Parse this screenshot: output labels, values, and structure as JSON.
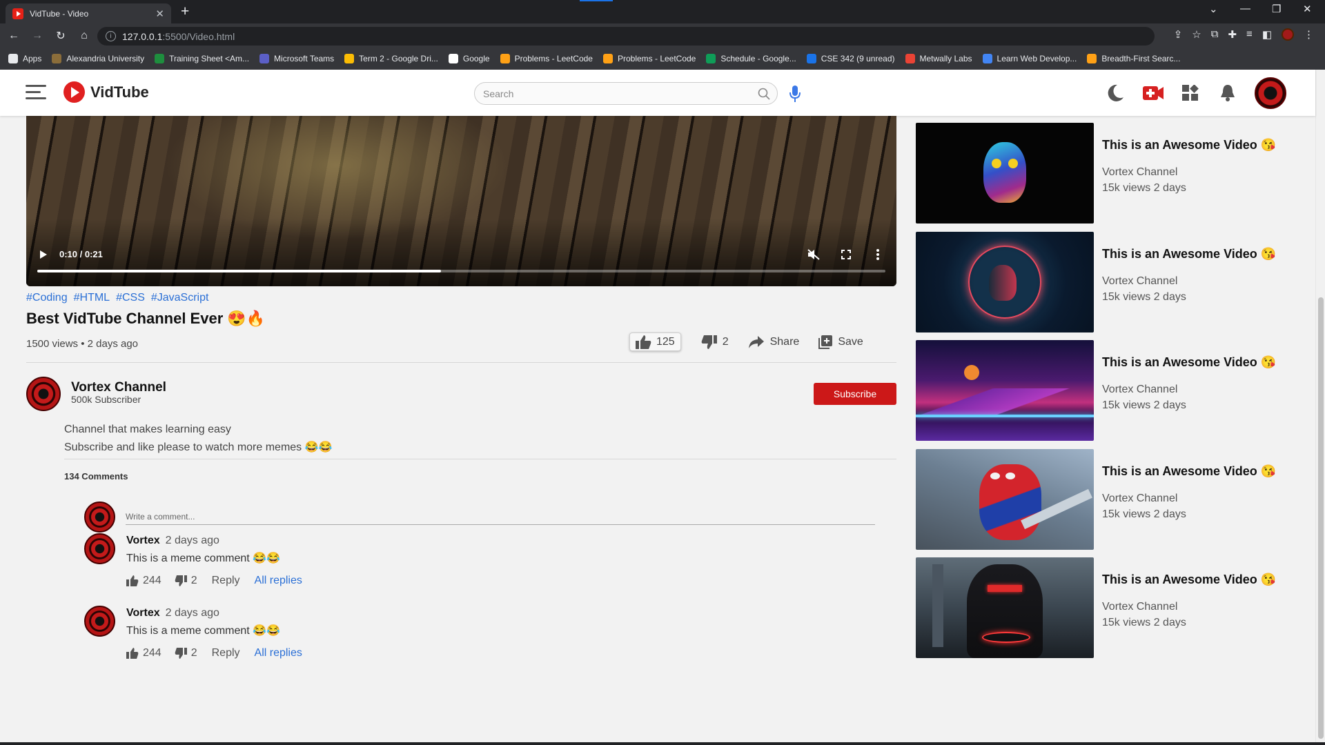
{
  "browser": {
    "tab_title": "VidTube - Video",
    "url_host": "127.0.0.1",
    "url_path": ":5500/Video.html",
    "bookmarks": [
      {
        "label": "Apps",
        "color": "#e8eaed"
      },
      {
        "label": "Alexandria University",
        "color": "#8b6d3a"
      },
      {
        "label": "Training Sheet <Am...",
        "color": "#1e8e3e"
      },
      {
        "label": "Microsoft Teams",
        "color": "#5b5fc7"
      },
      {
        "label": "Term 2 - Google Dri...",
        "color": "#fbbc04"
      },
      {
        "label": "Google",
        "color": "#ffffff"
      },
      {
        "label": "Problems - LeetCode",
        "color": "#ffa116"
      },
      {
        "label": "Problems - LeetCode",
        "color": "#ffa116"
      },
      {
        "label": "Schedule - Google...",
        "color": "#0f9d58"
      },
      {
        "label": "CSE 342 (9 unread)",
        "color": "#1a73e8"
      },
      {
        "label": "Metwally Labs",
        "color": "#ea4335"
      },
      {
        "label": "Learn Web Develop...",
        "color": "#4285f4"
      },
      {
        "label": "Breadth-First Searc...",
        "color": "#ffa116"
      }
    ]
  },
  "header": {
    "logo_text": "VidTube",
    "search_placeholder": "Search"
  },
  "video": {
    "time": "0:10 / 0:21",
    "progress": 0.4762,
    "tags": [
      "#Coding",
      "#HTML",
      "#CSS",
      "#JavaScript"
    ],
    "title": "Best VidTube Channel Ever 😍🔥",
    "meta": "1500 views • 2 days ago",
    "likes": "125",
    "dislikes": "2",
    "share_label": "Share",
    "save_label": "Save"
  },
  "channel": {
    "name": "Vortex Channel",
    "subscribers": "500k Subscriber",
    "subscribe_label": "Subscribe",
    "description_line1": "Channel that makes learning easy",
    "description_line2": "Subscribe and like please to watch more memes 😂😂"
  },
  "comments": {
    "count_label": "134 Comments",
    "input_placeholder": "Write a comment...",
    "items": [
      {
        "author": "Vortex",
        "time": "2 days ago",
        "text": "This is a meme comment 😂😂",
        "likes": "244",
        "dislikes": "2",
        "reply_label": "Reply",
        "all_replies_label": "All replies"
      },
      {
        "author": "Vortex",
        "time": "2 days ago",
        "text": "This is a meme comment 😂😂",
        "likes": "244",
        "dislikes": "2",
        "reply_label": "Reply",
        "all_replies_label": "All replies"
      }
    ]
  },
  "suggestions": [
    {
      "title": "This is an Awesome Video 😘",
      "channel": "Vortex Channel",
      "views": "15k views 2 days",
      "theme": "owl"
    },
    {
      "title": "This is an Awesome Video 😘",
      "channel": "Vortex Channel",
      "views": "15k views 2 days",
      "theme": "skull"
    },
    {
      "title": "This is an Awesome Video 😘",
      "channel": "Vortex Channel",
      "views": "15k views 2 days",
      "theme": "synthwave"
    },
    {
      "title": "This is an Awesome Video 😘",
      "channel": "Vortex Channel",
      "views": "15k views 2 days",
      "theme": "spiderman"
    },
    {
      "title": "This is an Awesome Video 😘",
      "channel": "Vortex Channel",
      "views": "15k views 2 days",
      "theme": "batman"
    }
  ],
  "colors": {
    "accent": "#cc1818",
    "link": "#2a6fd6"
  }
}
